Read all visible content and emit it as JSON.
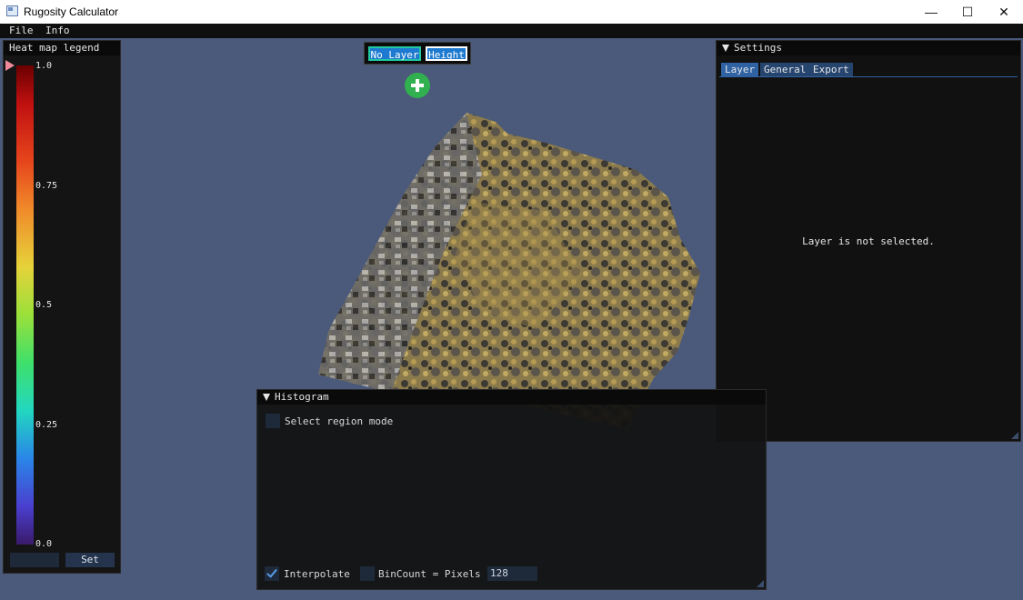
{
  "window": {
    "title": "Rugosity Calculator",
    "controls": [
      "—",
      "☐",
      "✕"
    ]
  },
  "menu": {
    "items": [
      "File",
      "Info"
    ]
  },
  "legend": {
    "title": "Heat map legend",
    "ticks": [
      "1.0",
      "0.75",
      "0.5",
      "0.25",
      "0.0"
    ],
    "input_value": "",
    "set_label": "Set"
  },
  "layer_selector": {
    "no_layer_label": "No Layer",
    "height_label": "Height"
  },
  "settings": {
    "title": "Settings",
    "tabs": [
      "Layer",
      "General",
      "Export"
    ],
    "active_tab": "Layer",
    "message": "Layer is not selected."
  },
  "histogram": {
    "title": "Histogram",
    "select_region_label": "Select region mode",
    "select_region_checked": false,
    "interpolate_label": "Interpolate",
    "interpolate_checked": true,
    "bincount_label": "BinCount = Pixels",
    "bincount_checked": false,
    "bincount_value": "128"
  },
  "colors": {
    "accent": "#2f62a3",
    "add_button": "#31b050",
    "no_layer_border": "#22c8a0",
    "viewport_bg": "#4b5a7a"
  }
}
